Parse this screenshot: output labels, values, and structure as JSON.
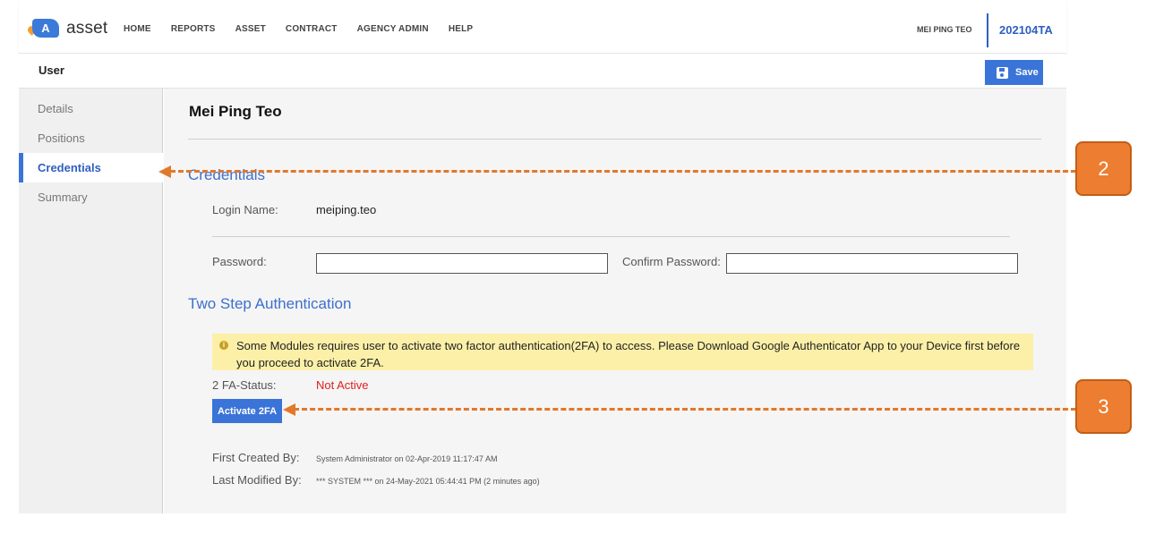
{
  "app": {
    "logo_letter": "A",
    "logo_text": "asset",
    "nav": [
      "HOME",
      "REPORTS",
      "ASSET",
      "CONTRACT",
      "AGENCY ADMIN",
      "HELP"
    ],
    "user_name": "MEI PING TEO",
    "tenant_code": "202104TA"
  },
  "page": {
    "title": "User",
    "save_label": "Save"
  },
  "sidebar": {
    "items": [
      {
        "label": "Details",
        "active": false
      },
      {
        "label": "Positions",
        "active": false
      },
      {
        "label": "Credentials",
        "active": true
      },
      {
        "label": "Summary",
        "active": false
      }
    ]
  },
  "main": {
    "person_name": "Mei Ping Teo",
    "credentials": {
      "title": "Credentials",
      "login_label": "Login Name:",
      "login_value": "meiping.teo",
      "password_label": "Password:",
      "password_value": "",
      "confirm_label": "Confirm Password:",
      "confirm_value": ""
    },
    "two_step": {
      "title": "Two Step Authentication",
      "notice": "Some Modules requires user to activate two factor authentication(2FA) to access. Please Download Google Authenticator App to your Device first before you proceed to activate 2FA.",
      "status_label": "2 FA-Status:",
      "status_value": "Not Active",
      "activate_label": "Activate 2FA"
    },
    "audit": {
      "created_label": "First Created By:",
      "created_value": "System Administrator on 02-Apr-2019 11:17:47 AM",
      "modified_label": "Last Modified By:",
      "modified_value": "*** SYSTEM *** on 24-May-2021 05:44:41 PM (2 minutes ago)"
    }
  },
  "annotations": {
    "credentials_marker": "2",
    "activate_marker": "3",
    "color": "#ED7D31"
  },
  "colors": {
    "accent": "#3B74D8",
    "section_title": "#3D6FCC",
    "error": "#E02020",
    "notice_bg": "#FCF0A8"
  }
}
